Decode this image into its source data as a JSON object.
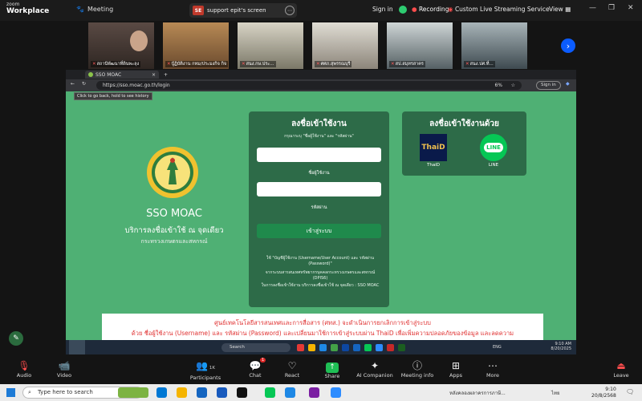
{
  "zoom_top": {
    "logo_small": "zoom",
    "logo_big": "Workplace",
    "meeting_label": "Meeting",
    "share_badge": "SE",
    "share_label": "support epit's screen",
    "share_more": "⋯",
    "sign_in": "Sign in",
    "recording": "Recording",
    "live_stream": "Custom Live Streaming Service",
    "view": "View",
    "win_min": "—",
    "win_max": "❐",
    "win_close": "✕"
  },
  "participants_strip": [
    {
      "name": "สถานีพัฒนาที่ดินพะลุง",
      "muted": true,
      "bg": "#4a3f3a"
    },
    {
      "name": "ปู้ฏิบัติงาน กทม/ประมงกิจ กิจ",
      "muted": true,
      "bg": "#7a5a3a"
    },
    {
      "name": "สนง.กษ.ประ...",
      "muted": true,
      "bg": "#6b6b5a"
    },
    {
      "name": "ศศภ.สุพรรณบุรี",
      "muted": true,
      "bg": "#8a8278"
    },
    {
      "name": "สป.สมุทรสาคร",
      "muted": true,
      "bg": "#6f7a7c"
    },
    {
      "name": "สนง.ปศ.ที่...",
      "muted": true,
      "bg": "#5c6a70"
    }
  ],
  "browser": {
    "tab_title": "SSO MOAC",
    "tab_close": "×",
    "new_tab": "+",
    "url": "https://sso.moac.go.th/login",
    "zoom_level": "6%",
    "signin_chip": "Sign in",
    "tooltip": "Click to go back, hold to see history"
  },
  "brand": {
    "name": "SSO MOAC",
    "subtitle": "บริการลงชื่อเข้าใช้ ณ จุดเดียว",
    "ministry": "กระทรวงเกษตรและสหกรณ์"
  },
  "login_form": {
    "title": "ลงชื่อเข้าใช้งาน",
    "hint": "กรุณาระบุ \"ชื่อผู้ใช้งาน\" และ \"รหัสผ่าน\"",
    "username_label": "ชื่อผู้ใช้งาน",
    "password_label": "รหัสผ่าน",
    "submit": "เข้าสู่ระบบ",
    "note1": "ใช้ \"บัญชีผู้ใช้งาน (Username/User Account) และ รหัสผ่าน (Password)\"",
    "note2": "จากระบบสารสนเทศทรัพยากรบุคคลกระทรวงเกษตรและสหกรณ์ (DPIS6)",
    "note3": "ในการลงชื่อเข้าใช้งาน บริการลงชื่อเข้าใช้ ณ จุดเดียว : SSO MOAC"
  },
  "sso_options": {
    "title": "ลงชื่อเข้าใช้งานด้วย",
    "thaid_label": "ThaiD",
    "thaid_icon_text": "ThaiD",
    "line_label": "LINE",
    "line_icon_text": "LINE"
  },
  "notice": {
    "line1": "ศูนย์เทคโนโลยีสารสนเทศและการสื่อสาร (ศทส.) จะดำเนินการยกเลิกการเข้าสู่ระบบ",
    "line2": "ด้วย ชื่อผู้ใช้งาน (Username) และ รหัสผ่าน (Password) และเปลี่ยนมาใช้การเข้าสู่ระบบผ่าน ThaiD เพื่อเพิ่มความปลอดภัยของข้อมูล และลดความ"
  },
  "inner_taskbar": {
    "search": "Search",
    "lang": "ENG",
    "time": "9:10 AM",
    "date": "8/20/2025"
  },
  "controls": {
    "audio": "Audio",
    "video": "Video",
    "participants": "Participants",
    "participants_count": "1K",
    "chat": "Chat",
    "chat_badge": "1",
    "react": "React",
    "share": "Share",
    "ai": "AI Companion",
    "meeting_info": "Meeting info",
    "apps": "Apps",
    "more": "More",
    "leave": "Leave"
  },
  "win_taskbar": {
    "search_placeholder": "Type here to search",
    "task_label": "หลังคลองผลาครการภาษี...",
    "lang": "ไทย",
    "time": "9:10",
    "date": "20/8/2568"
  },
  "colors": {
    "page_green": "#4fb074",
    "card_green": "#2d6b48",
    "zoom_blue": "#0b5cff",
    "recording_green": "#2ecc71",
    "notice_red": "#e03030"
  }
}
